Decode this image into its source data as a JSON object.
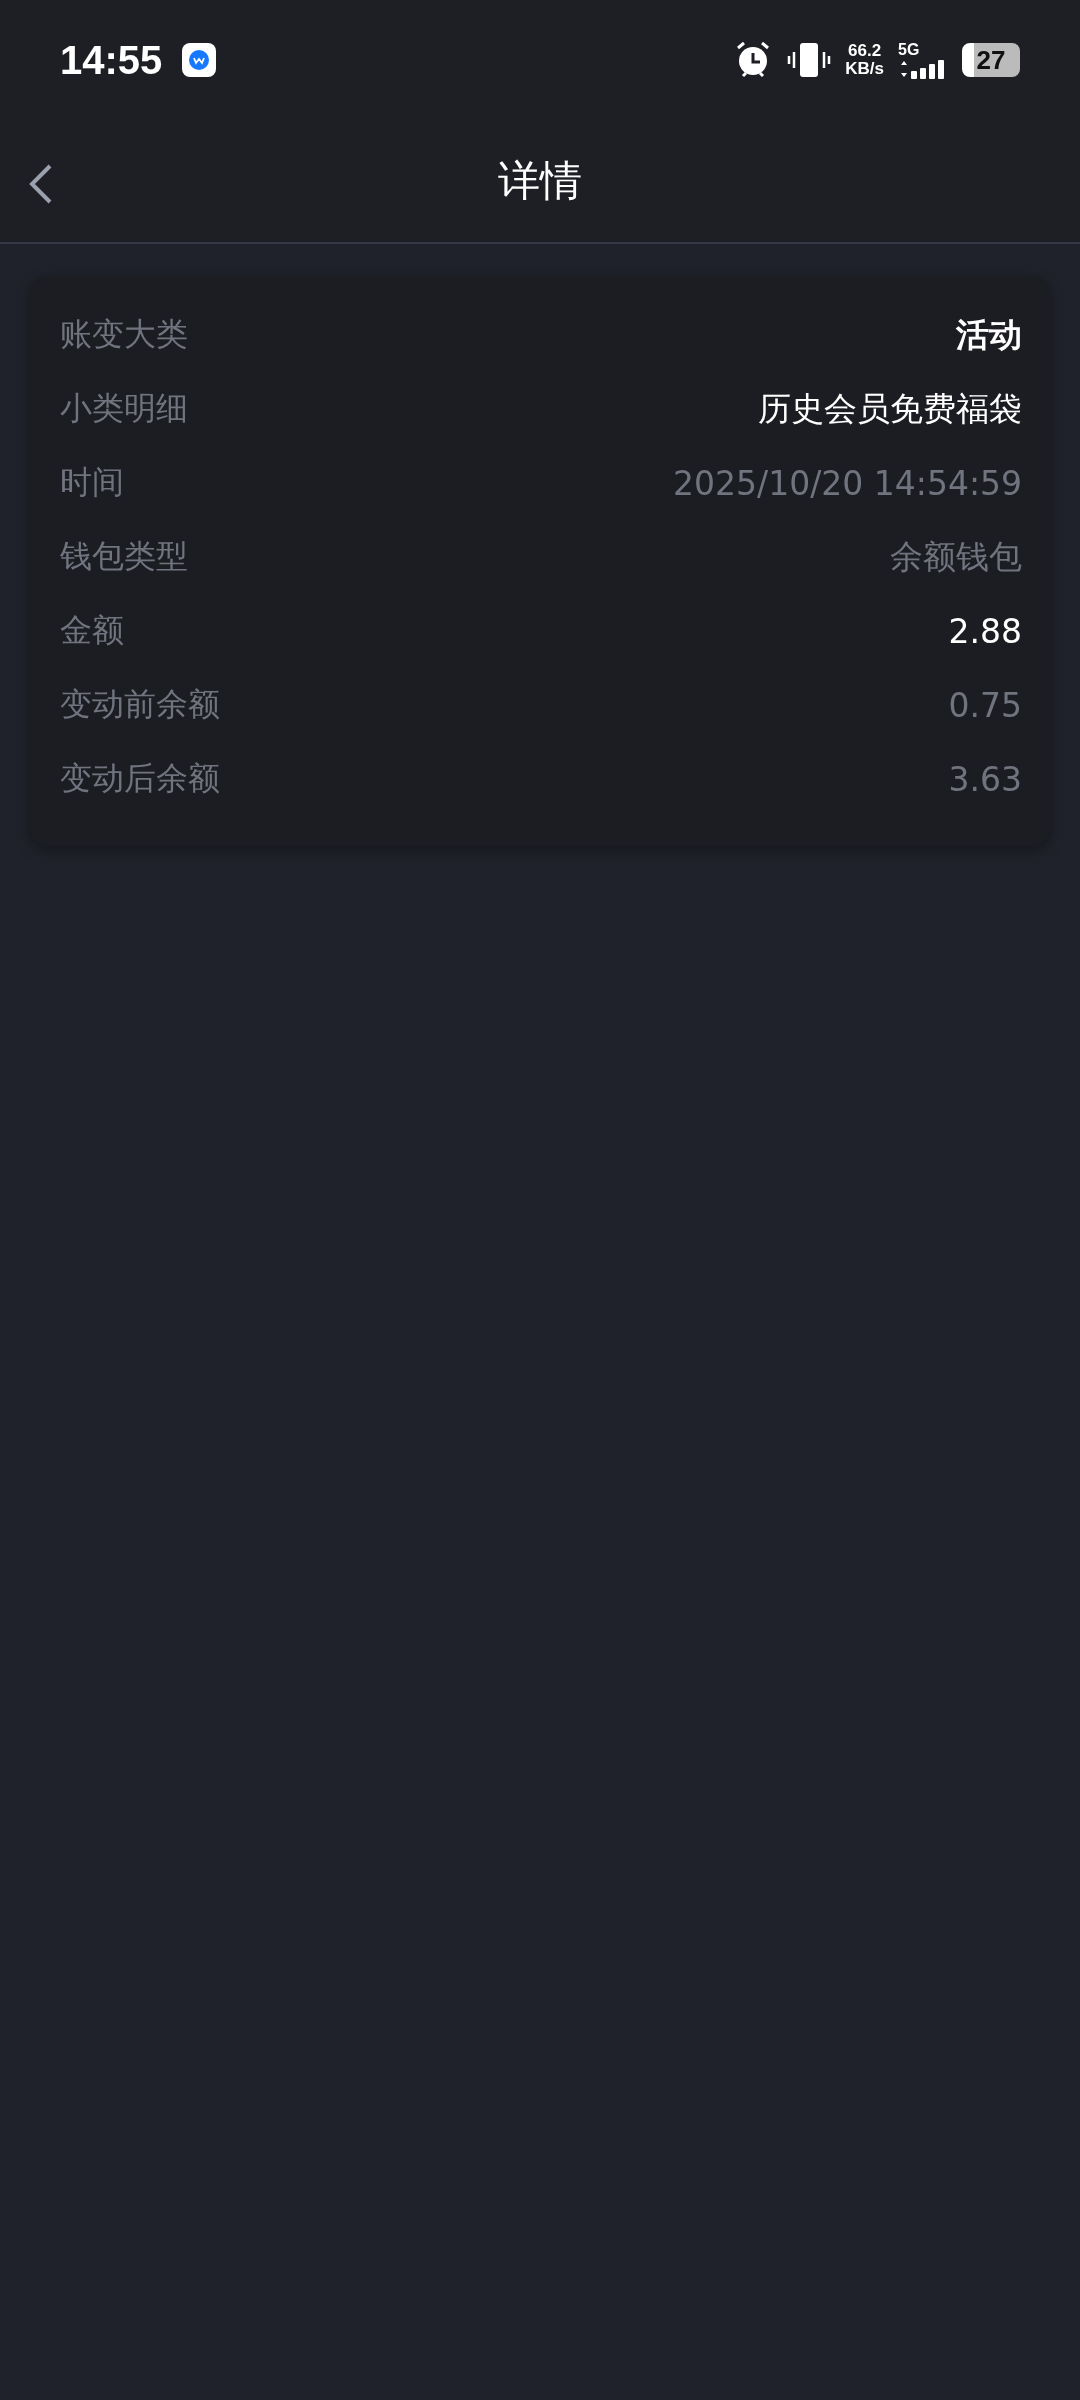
{
  "status_bar": {
    "time": "14:55",
    "network_speed": "66.2",
    "network_speed_unit": "KB/s",
    "network_type": "5G",
    "battery": "27"
  },
  "header": {
    "title": "详情"
  },
  "details": [
    {
      "label": "账变大类",
      "value": "活动",
      "kind": "strong"
    },
    {
      "label": "小类明细",
      "value": "历史会员免费福袋",
      "kind": "plain"
    },
    {
      "label": "时间",
      "value": "2025/10/20 14:54:59",
      "kind": "muted"
    },
    {
      "label": "钱包类型",
      "value": "余额钱包",
      "kind": "muted"
    },
    {
      "label": "金额",
      "value": "2.88",
      "kind": "plain"
    },
    {
      "label": "变动前余额",
      "value": "0.75",
      "kind": "muted"
    },
    {
      "label": "变动后余额",
      "value": "3.63",
      "kind": "muted"
    }
  ]
}
